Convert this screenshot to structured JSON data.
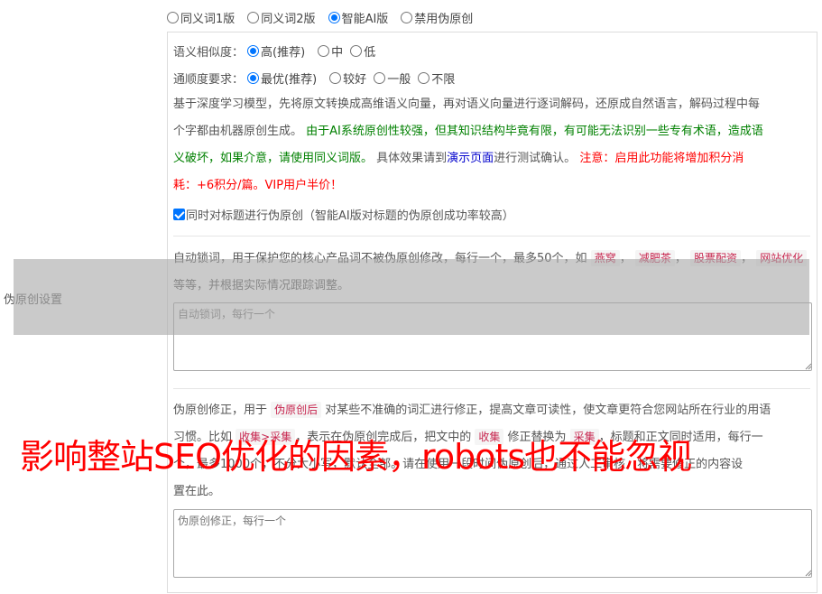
{
  "mode_options": [
    {
      "label": "同义词1版",
      "selected": false
    },
    {
      "label": "同义词2版",
      "selected": false
    },
    {
      "label": "智能AI版",
      "selected": true
    },
    {
      "label": "禁用伪原创",
      "selected": false
    }
  ],
  "similarity": {
    "label": "语义相似度：",
    "options": [
      {
        "label": "高(推荐)",
        "selected": true
      },
      {
        "label": "中",
        "selected": false
      },
      {
        "label": "低",
        "selected": false
      }
    ]
  },
  "fluency": {
    "label": "通顺度要求：",
    "options": [
      {
        "label": "最优(推荐)",
        "selected": true
      },
      {
        "label": "较好",
        "selected": false
      },
      {
        "label": "一般",
        "selected": false
      },
      {
        "label": "不限",
        "selected": false
      }
    ]
  },
  "description": {
    "line1": "基于深度学习模型，先将原文转换成高维语义向量，再对语义向量进行逐词解码，还原成自然语言，解码过程中每",
    "line2_start": "个字都由机器原创生成。 ",
    "line2_green": "由于AI系统原创性较强，但其知识结构毕竟有限，有可能无法识别一些专有术语，造成语",
    "line3_green": "义破坏，如果介意，请使用同义词版。",
    "line3_mid": " 具体效果请到",
    "line3_link": "演示页面",
    "line3_after": "进行测试确认。 ",
    "line3_red": "注意：启用此功能将增加积分消",
    "line4_red": "耗：+6积分/篇。VIP用户半价！"
  },
  "title_checkbox": {
    "label": "同时对标题进行伪原创（智能AI版对标题的伪原创成功率较高）",
    "checked": true
  },
  "section_label": "伪原创设置",
  "lock_words": {
    "text_before": "自动锁词，用于保护您的核心产品词不被伪原创修改，每行一个，最多50个，如",
    "examples": [
      "燕窝",
      "减肥茶",
      "股票配资",
      "网站优化"
    ],
    "separator": "，",
    "text_after": " 等等，并根据实际情况跟踪调整。",
    "placeholder": "自动锁词，每行一个"
  },
  "correction": {
    "text1": "伪原创修正，用于 ",
    "kw1": "伪原创后",
    "text2": " 对某些不准确的词汇进行修正，提高文章可读性，使文章更符合您网站所在行业的用语",
    "text3": "习惯。比如 ",
    "kw2": "收集>采集",
    "text4": "，表示在伪原创完成后，把文中的 ",
    "kw3": "收集",
    "text5": " 修正替换为 ",
    "kw4": "采集",
    "text6": "，标题和正文同时适用，每行一",
    "text7": "个，最多1000个，不分大小写，默认全部。请在使用一段时间伪原创后，通过人工审核，将需要修正的内容设",
    "text8": "置在此。",
    "placeholder": "伪原创修正，每行一个"
  },
  "watermark": "影响整站SEO优化的因素，robots也不能忽视",
  "colors": {
    "accent": "#0075ff",
    "green_text": "#008000",
    "link_blue": "#0000cc",
    "warning_red": "#ff0000",
    "keyword_pink": "#c7254e"
  }
}
